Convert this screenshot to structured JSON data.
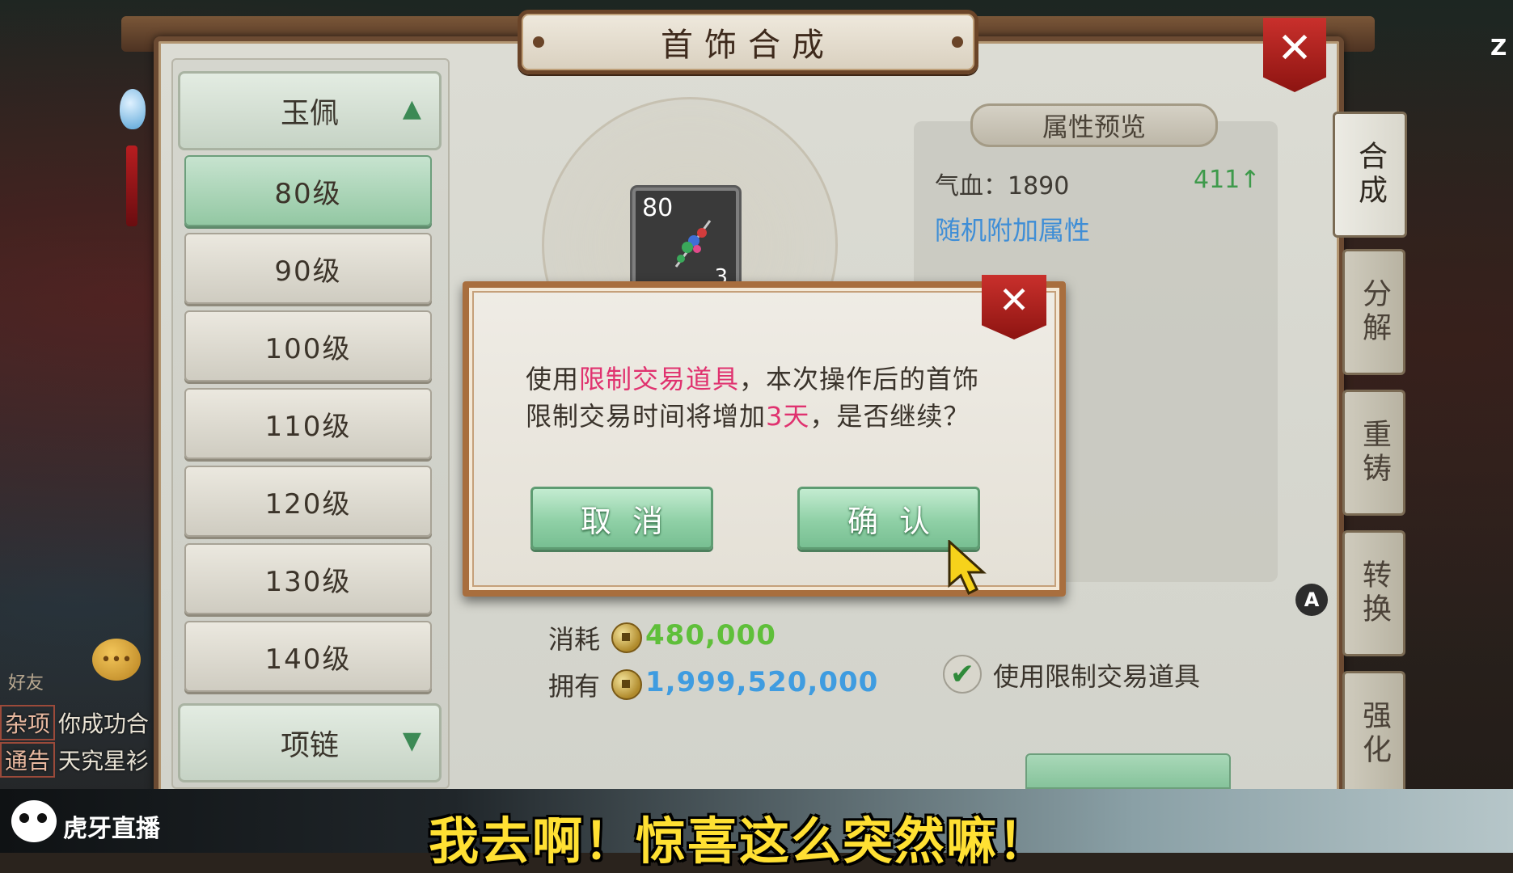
{
  "window": {
    "title": "首饰合成",
    "corner_key": "Z"
  },
  "categories": {
    "current": {
      "label": "玉佩",
      "expanded": true
    },
    "levels": [
      "80级",
      "90级",
      "100级",
      "110级",
      "120级",
      "130级",
      "140级"
    ],
    "active_level": "80级",
    "next": {
      "label": "项链",
      "expanded": false
    }
  },
  "side_tabs": [
    {
      "label": "合成",
      "active": true
    },
    {
      "label": "分解",
      "active": false
    },
    {
      "label": "重铸",
      "active": false
    },
    {
      "label": "转换",
      "active": false
    },
    {
      "label": "强化",
      "active": false
    }
  ],
  "item": {
    "level": "80",
    "count": "3"
  },
  "attributes": {
    "title": "属性预览",
    "hp_line": "气血：1890",
    "hp_increase": "411↑",
    "random_bonus": "随机附加属性"
  },
  "cost": {
    "consume_label": "消耗",
    "consume_value": "480,000",
    "own_label": "拥有",
    "own_value": "1,999,520,000",
    "use_restricted_label": "使用限制交易道具",
    "use_restricted_checked": true
  },
  "dialog": {
    "line1_a": "使用",
    "line1_hl": "限制交易道具",
    "line1_b": "，本次操作后的首饰",
    "line2_a": "限制交易时间将增加",
    "line2_hl": "3天",
    "line2_b": "，是否继续？",
    "cancel_label": "取消",
    "confirm_label": "确认"
  },
  "hud": {
    "a_badge": "A",
    "friend_label": "好友",
    "chat_line1_tag": "杂项",
    "chat_line1_text": "你成功合",
    "chat_line2_tag": "通告",
    "chat_line2_text": "天究星衫"
  },
  "stream": {
    "platform": "虎牙直播",
    "subtitle": "我去啊！惊喜这么突然嘛！"
  },
  "colors": {
    "highlight": "#e0326f",
    "consume_value": "#5fbf3a",
    "own_value": "#3f9ce0",
    "subtitle": "#ffe033"
  }
}
